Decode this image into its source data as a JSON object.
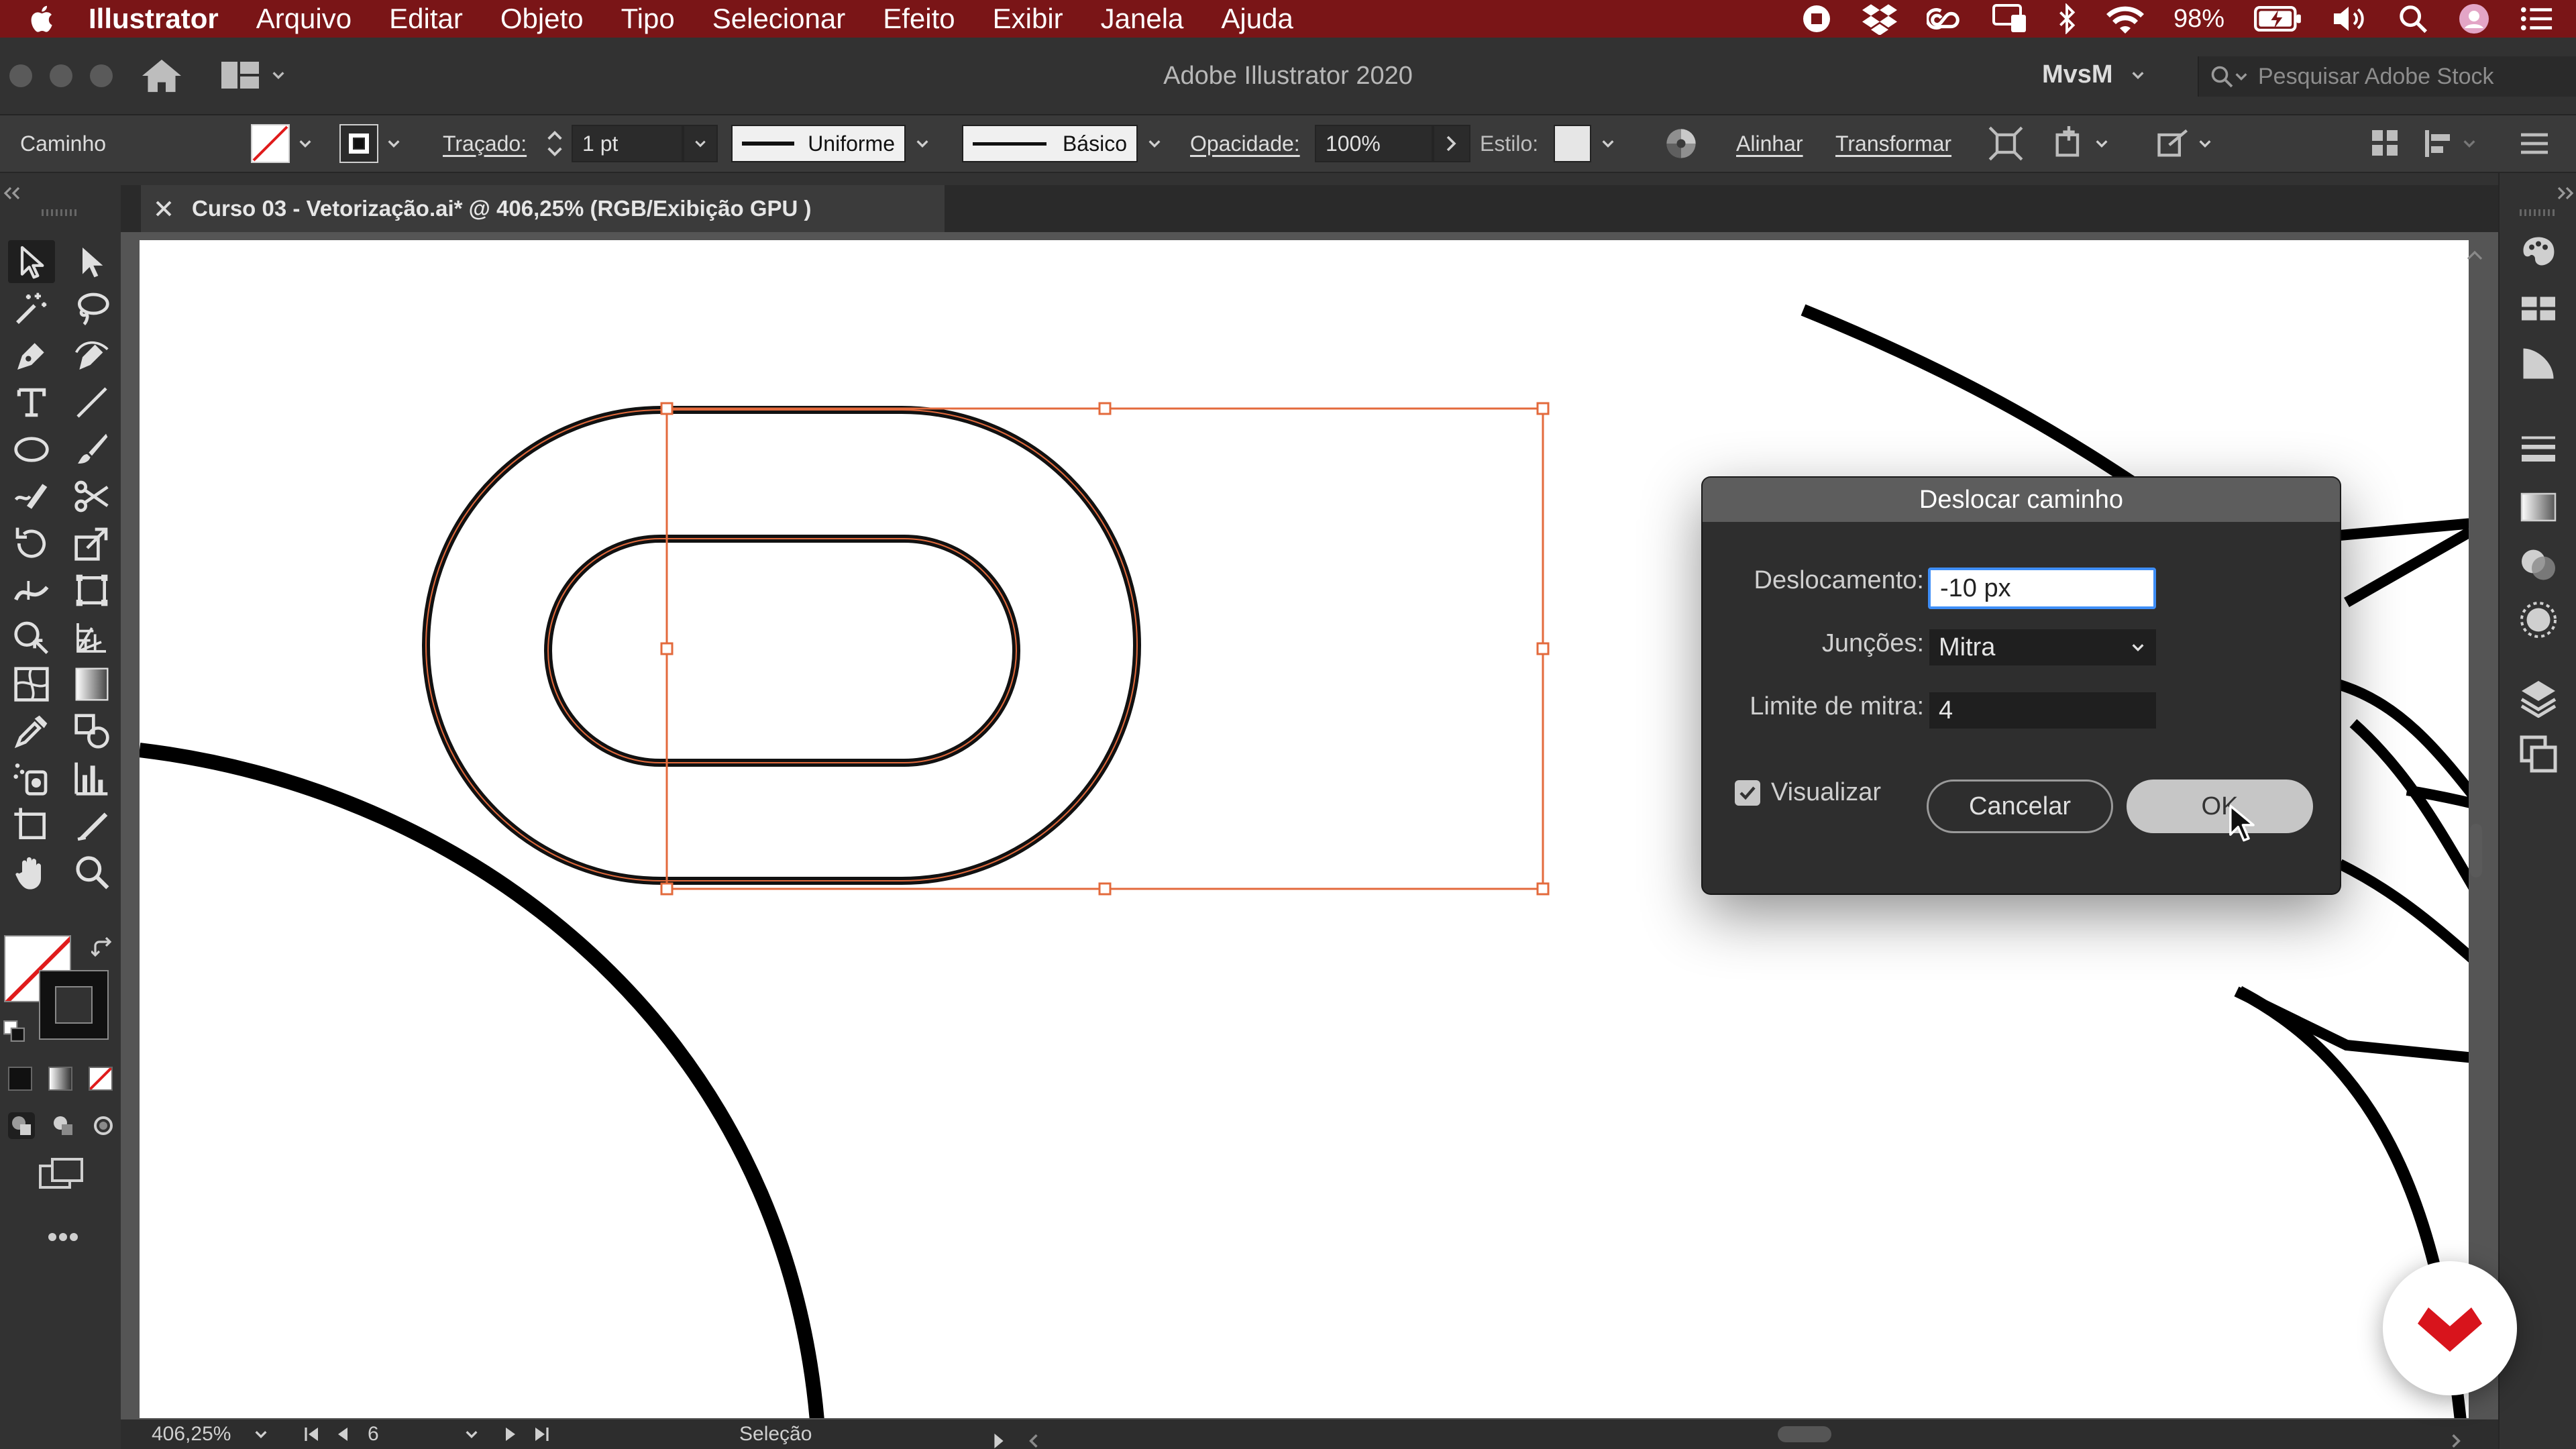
{
  "menubar": {
    "app_name": "Illustrator",
    "items": [
      "Arquivo",
      "Editar",
      "Objeto",
      "Tipo",
      "Selecionar",
      "Efeito",
      "Exibir",
      "Janela",
      "Ajuda"
    ],
    "battery": "98%"
  },
  "appbar": {
    "title": "Adobe Illustrator 2020",
    "user": "MvsM",
    "search_placeholder": "Pesquisar Adobe Stock"
  },
  "controlbar": {
    "object_label": "Caminho",
    "stroke_label": "Traçado:",
    "stroke_weight": "1 pt",
    "profile": "Uniforme",
    "brush": "Básico",
    "opacity_label": "Opacidade:",
    "opacity_value": "100%",
    "style_label": "Estilo:",
    "align": "Alinhar",
    "transform": "Transformar"
  },
  "document_tab": {
    "title": "Curso 03 - Vetorização.ai* @ 406,25% (RGB/Exibição GPU )"
  },
  "dialog": {
    "title": "Deslocar caminho",
    "offset_label": "Deslocamento:",
    "offset_value": "-10 px",
    "joins_label": "Junções:",
    "joins_value": "Mitra",
    "miter_label": "Limite de mitra:",
    "miter_value": "4",
    "preview_label": "Visualizar",
    "preview_checked": true,
    "cancel": "Cancelar",
    "ok": "OK"
  },
  "statusbar": {
    "zoom": "406,25%",
    "artboard": "6",
    "tool": "Seleção"
  },
  "colors": {
    "menubar": "#7a1517",
    "selection": "#e36a3c",
    "accent_blue": "#3e8ef7",
    "brand_red": "#d8141c"
  }
}
